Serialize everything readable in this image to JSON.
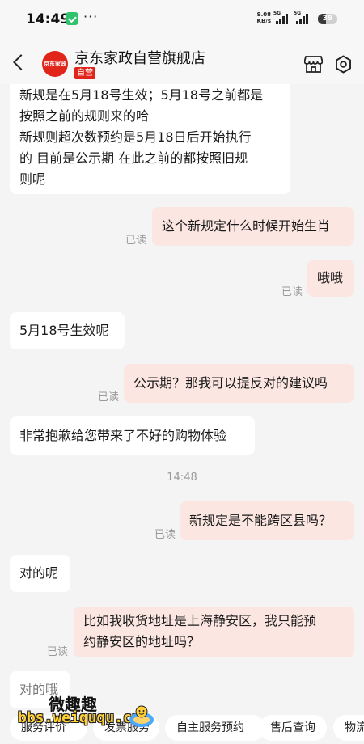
{
  "status_bar": {
    "time": "14:49",
    "dots": "···",
    "net_speed": "9.08",
    "net_unit": "KB/s",
    "signal1": "5G",
    "signal2": "5G",
    "battery": "39"
  },
  "header": {
    "logo_text": "京东家政",
    "shop_name": "京东家政自营旗舰店",
    "badge": "自营"
  },
  "messages": {
    "m1": "新规是在5月18号生效；5月18号之前都是\n按照之前的规则来的哈\n新规则超次数预约是5月18日后开始执行\n的 目前是公示期 在此之前的都按照旧规\n则呢",
    "m2": "这个新规定什么时候开始生肖",
    "m3": "哦哦",
    "m4": "5月18号生效呢",
    "m5": "公示期？那我可以提反对的建议吗",
    "m6": "非常抱歉给您带来了不好的购物体验",
    "time_divider": "14:48",
    "m7": "新规定是不能跨区县吗？",
    "m8": "对的呢",
    "m9": "比如我收货地址是上海静安区，我只能预\n约静安区的地址吗？",
    "m10": "对的哦",
    "read": "已读"
  },
  "quick_actions": [
    "服务评价",
    "发票服务",
    "自主服务预约",
    "售后查询",
    "物流"
  ],
  "watermark": {
    "cn": "微趣趣",
    "url": "bbs.weiququ.cn"
  },
  "colors": {
    "brand_red": "#e1251b",
    "outgoing_bubble": "#fbe6e1",
    "incoming_bubble": "#ffffff",
    "background": "#f4f4f4"
  }
}
